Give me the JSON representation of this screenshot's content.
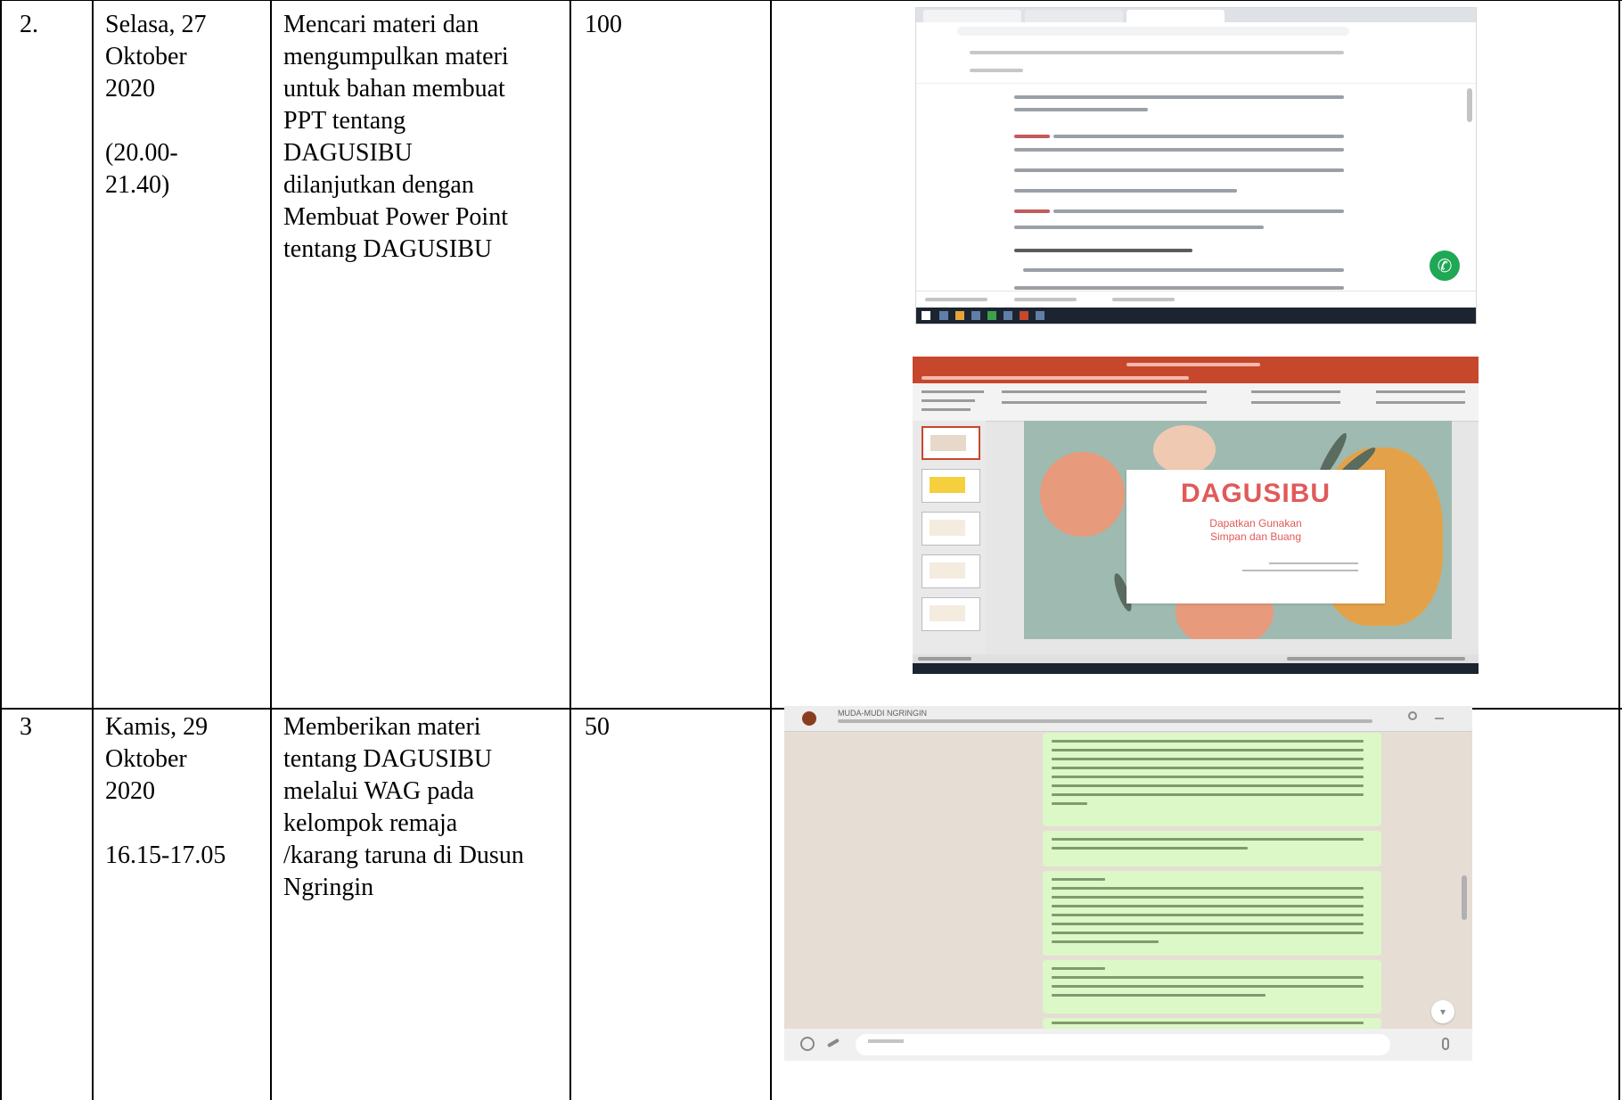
{
  "rows": [
    {
      "no": "2.",
      "date": "Selasa, 27\nOktober\n2020\n\n(20.00-\n21.40)",
      "activity": "Mencari materi dan\nmengumpulkan materi\nuntuk bahan membuat\nPPT tentang\nDAGUSIBU\ndilanjutkan dengan\nMembuat Power Point\ntentang DAGUSIBU",
      "value": "100"
    },
    {
      "no": "3",
      "date": "Kamis, 29\nOktober\n2020\n\n16.15-17.05",
      "activity": "Memberikan materi\ntentang DAGUSIBU\nmelalui WAG pada\nkelompok remaja\n/karang taruna di Dusun\nNgringin",
      "value": "50"
    }
  ],
  "slide": {
    "title": "DAGUSIBU",
    "subtitle": "Dapatkan Gunakan\nSimpan dan Buang",
    "title_color": "#e05a5a",
    "background_color": "#9fbab0"
  },
  "whatsapp": {
    "group_name": "MUDA-MUDI NGRINGIN",
    "bubble_color": "#dcf8c6",
    "icons": [
      "search-icon",
      "menu-icon",
      "emoji-icon",
      "attach-icon",
      "mic-icon",
      "scroll-down-icon"
    ]
  },
  "browser": {
    "icons": [
      "whatsapp-icon"
    ]
  }
}
